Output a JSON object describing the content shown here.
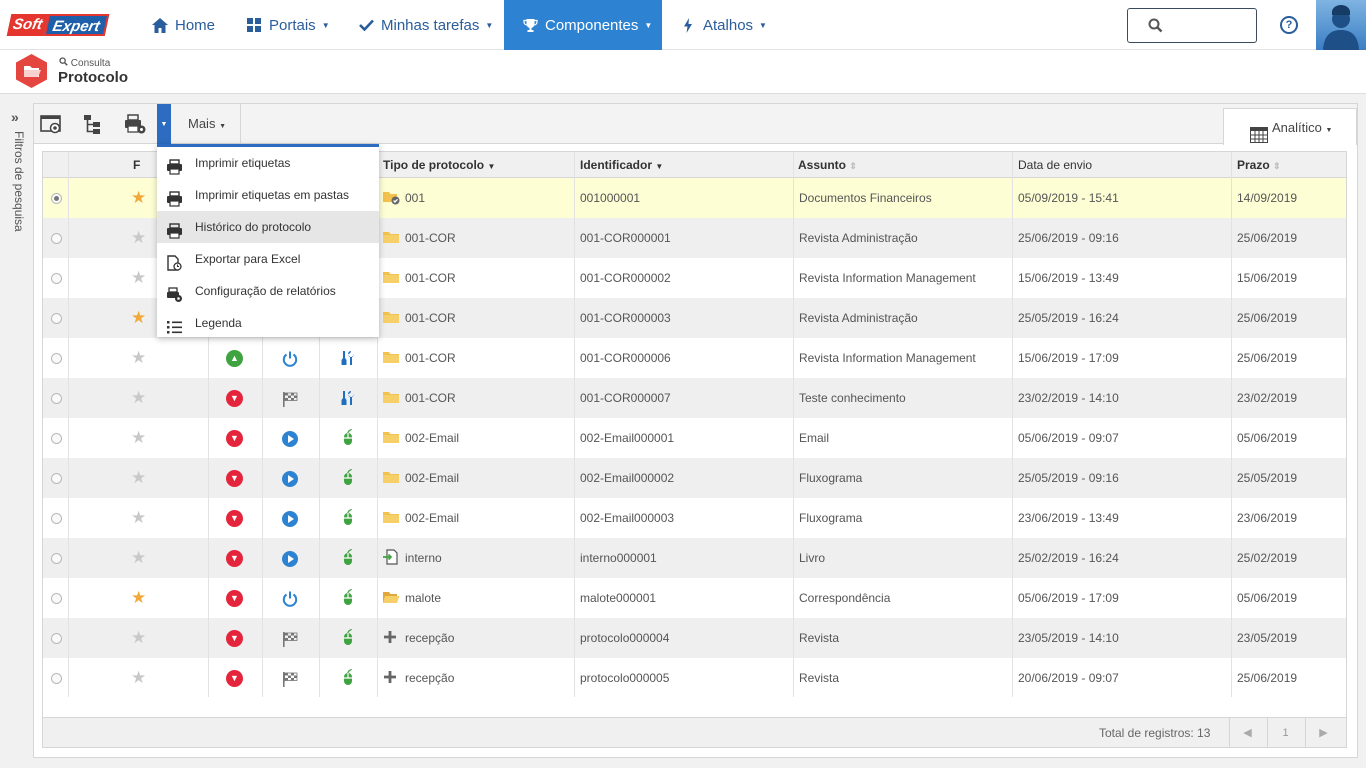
{
  "brand": {
    "part1": "Soft",
    "part2": "Expert"
  },
  "nav": {
    "home": "Home",
    "portais": "Portais",
    "tarefas": "Minhas tarefas",
    "componentes": "Componentes",
    "atalhos": "Atalhos"
  },
  "header": {
    "help": "?"
  },
  "breadcrumb": {
    "parent": "Consulta",
    "title": "Protocolo"
  },
  "sidebar": {
    "label": "Filtros de pesquisa"
  },
  "toolbar": {
    "mais": "Mais",
    "view": "Analítico"
  },
  "menu": [
    "Imprimir etiquetas",
    "Imprimir etiquetas em pastas",
    "Histórico do protocolo",
    "Exportar para Excel",
    "Configuração de relatórios",
    "Legenda"
  ],
  "columns": {
    "f": "F",
    "tipo": "Tipo de protocolo",
    "identificador": "Identificador",
    "assunto": "Assunto",
    "data": "Data de envio",
    "prazo": "Prazo"
  },
  "rows": [
    {
      "fav": true,
      "status": "down",
      "phase": "play",
      "tool": "mouse",
      "type_icon": "folder-check",
      "tipo": "001",
      "id": "001000001",
      "assunto": "Documentos Financeiros",
      "data": "05/09/2019 - 15:41",
      "prazo": "14/09/2019"
    },
    {
      "fav": false,
      "status": "down",
      "phase": "play",
      "tool": "mouse",
      "type_icon": "folder",
      "tipo": "001-COR",
      "id": "001-COR000001",
      "assunto": "Revista Administração",
      "data": "25/06/2019 - 09:16",
      "prazo": "25/06/2019"
    },
    {
      "fav": false,
      "status": "down",
      "phase": "play",
      "tool": "mouse",
      "type_icon": "folder",
      "tipo": "001-COR",
      "id": "001-COR000002",
      "assunto": "Revista Information Management",
      "data": "15/06/2019 - 13:49",
      "prazo": "15/06/2019"
    },
    {
      "fav": true,
      "status": "down",
      "phase": "play",
      "tool": "mouse",
      "type_icon": "folder",
      "tipo": "001-COR",
      "id": "001-COR000003",
      "assunto": "Revista Administração",
      "data": "25/05/2019 - 16:24",
      "prazo": "25/06/2019"
    },
    {
      "fav": false,
      "status": "up",
      "phase": "power",
      "tool": "tools",
      "type_icon": "folder",
      "tipo": "001-COR",
      "id": "001-COR000006",
      "assunto": "Revista Information Management",
      "data": "15/06/2019 - 17:09",
      "prazo": "25/06/2019"
    },
    {
      "fav": false,
      "status": "down",
      "phase": "flag",
      "tool": "tools",
      "type_icon": "folder",
      "tipo": "001-COR",
      "id": "001-COR000007",
      "assunto": "Teste conhecimento",
      "data": "23/02/2019 - 14:10",
      "prazo": "23/02/2019"
    },
    {
      "fav": false,
      "status": "down",
      "phase": "play",
      "tool": "mouse",
      "type_icon": "folder",
      "tipo": "002-Email",
      "id": "002-Email000001",
      "assunto": "Email",
      "data": "05/06/2019 - 09:07",
      "prazo": "05/06/2019"
    },
    {
      "fav": false,
      "status": "down",
      "phase": "play",
      "tool": "mouse",
      "type_icon": "folder",
      "tipo": "002-Email",
      "id": "002-Email000002",
      "assunto": "Fluxograma",
      "data": "25/05/2019 - 09:16",
      "prazo": "25/05/2019"
    },
    {
      "fav": false,
      "status": "down",
      "phase": "play",
      "tool": "mouse",
      "type_icon": "folder",
      "tipo": "002-Email",
      "id": "002-Email000003",
      "assunto": "Fluxograma",
      "data": "23/06/2019 - 13:49",
      "prazo": "23/06/2019"
    },
    {
      "fav": false,
      "status": "down",
      "phase": "play",
      "tool": "mouse",
      "type_icon": "doc-in",
      "tipo": "interno",
      "id": "interno000001",
      "assunto": "Livro",
      "data": "25/02/2019 - 16:24",
      "prazo": "25/02/2019"
    },
    {
      "fav": true,
      "status": "down",
      "phase": "power",
      "tool": "mouse",
      "type_icon": "folder-open",
      "tipo": "malote",
      "id": "malote000001",
      "assunto": "Correspondência",
      "data": "05/06/2019 - 17:09",
      "prazo": "05/06/2019"
    },
    {
      "fav": false,
      "status": "down",
      "phase": "flag",
      "tool": "mouse",
      "type_icon": "plus",
      "tipo": "recepção",
      "id": "protocolo000004",
      "assunto": "Revista",
      "data": "23/05/2019 - 14:10",
      "prazo": "23/05/2019"
    },
    {
      "fav": false,
      "status": "down",
      "phase": "flag",
      "tool": "mouse",
      "type_icon": "plus",
      "tipo": "recepção",
      "id": "protocolo000005",
      "assunto": "Revista",
      "data": "20/06/2019 - 09:07",
      "prazo": "25/06/2019"
    }
  ],
  "footer": {
    "total": "Total de registros: 13",
    "page": "1"
  },
  "colors": {
    "accent": "#2d83d1",
    "danger": "#e4253c",
    "success": "#3fa33f",
    "folder": "#f2c14e",
    "star_on": "#f0a93a",
    "star_off": "#c9c9c9"
  }
}
